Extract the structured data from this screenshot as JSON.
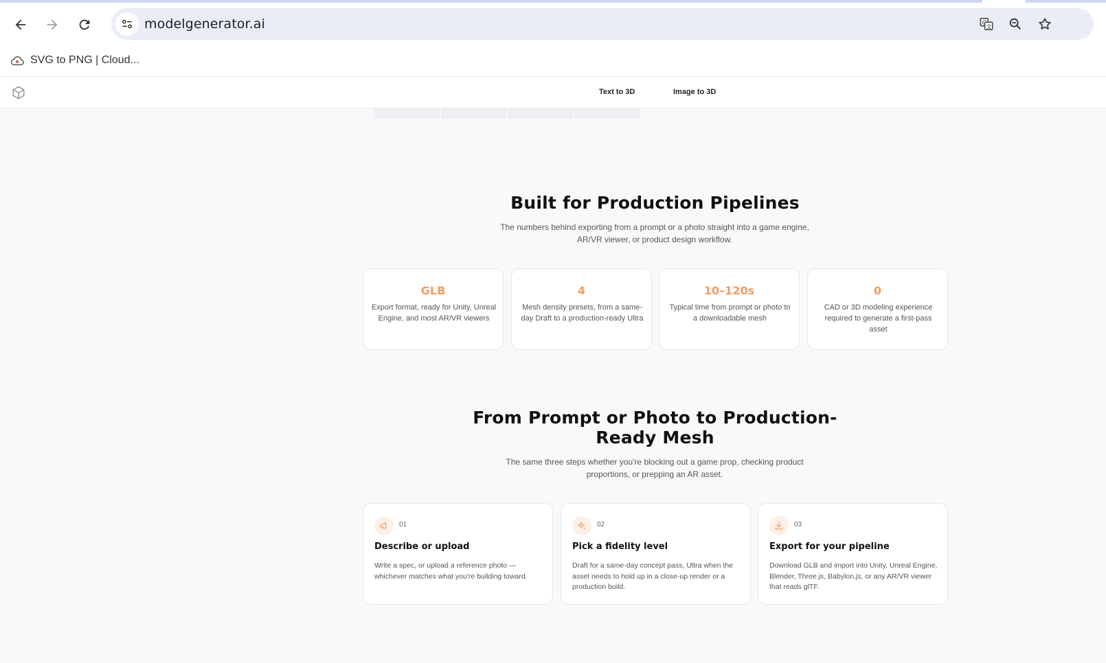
{
  "browser": {
    "url": "modelgenerator.ai",
    "bookmarks": [
      {
        "label": "SVG to PNG | Cloud..."
      }
    ]
  },
  "site": {
    "nav": [
      "Text to 3D",
      "Image to 3D"
    ]
  },
  "stats_section": {
    "title": "Built for Production Pipelines",
    "subtitle_line1": "The numbers behind exporting from a prompt or a photo straight into a game engine,",
    "subtitle_line2": "AR/VR viewer, or product design workflow.",
    "cards": [
      {
        "value": "GLB",
        "desc": "Export format, ready for Unity, Unreal Engine, and most AR/VR viewers"
      },
      {
        "value": "4",
        "desc": "Mesh density presets, from a same-day Draft to a production-ready Ultra"
      },
      {
        "value": "10–120s",
        "desc": "Typical time from prompt or photo to a downloadable mesh"
      },
      {
        "value": "0",
        "desc": "CAD or 3D modeling experience required to generate a first-pass asset"
      }
    ]
  },
  "steps_section": {
    "title_line1": "From Prompt or Photo to Production-",
    "title_line2": "Ready Mesh",
    "subtitle_line1": "The same three steps whether you're blocking out a game prop, checking product",
    "subtitle_line2": "proportions, or prepping an AR asset.",
    "steps": [
      {
        "num": "01",
        "icon": "megaphone-icon",
        "title": "Describe or upload",
        "desc": "Write a spec, or upload a reference photo — whichever matches what you're building toward."
      },
      {
        "num": "02",
        "icon": "sparkle-icon",
        "title": "Pick a fidelity level",
        "desc": "Draft for a same-day concept pass, Ultra when the asset needs to hold up in a close-up render or a production build."
      },
      {
        "num": "03",
        "icon": "download-icon",
        "title": "Export for your pipeline",
        "desc": "Download GLB and import into Unity, Unreal Engine, Blender, Three.js, Babylon.js, or any AR/VR viewer that reads glTF."
      }
    ]
  },
  "colors": {
    "accent": "#f29c63",
    "background": "#f8f9fb"
  }
}
